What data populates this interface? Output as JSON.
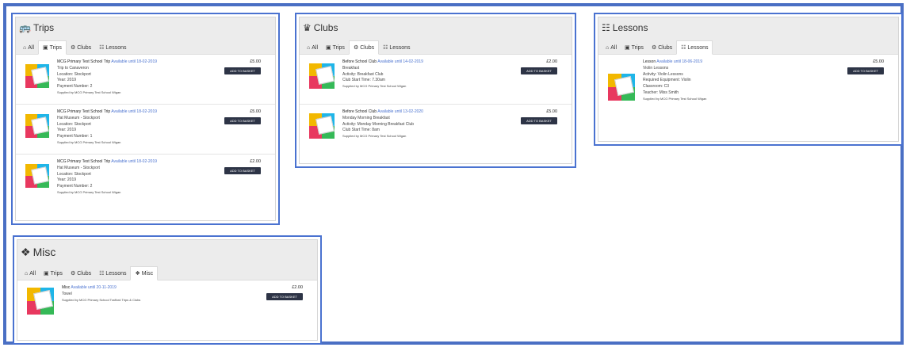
{
  "colors": {
    "frame": "#4a6fc4",
    "panel_border": "#4a72d0",
    "button": "#2d3446",
    "link": "#4a72d0"
  },
  "tab_labels": {
    "all": "All",
    "trips": "Trips",
    "clubs": "Clubs",
    "lessons": "Lessons",
    "misc": "Misc"
  },
  "panels": {
    "trips": {
      "title": "Trips",
      "items": [
        {
          "title": "MCG Primary Test School Trip",
          "available": "Available until 18-02-2019",
          "lines": [
            "Trip to Canaveron",
            "Location: Stockport",
            "Year: 2019",
            "Payment Number: 2"
          ],
          "supplier": "Supplied by MCG Primary Test School Wigan",
          "price": "£5.00",
          "button": "ADD TO BASKET"
        },
        {
          "title": "MCG Primary Test School Trip",
          "available": "Available until 18-02-2019",
          "lines": [
            "Hat Museum - Stockport",
            "Location: Stockport",
            "Year: 2019",
            "Payment Number: 1"
          ],
          "supplier": "Supplied by MCG Primary Test School Wigan",
          "price": "£5.00",
          "button": "ADD TO BASKET"
        },
        {
          "title": "MCG Primary Test School Trip",
          "available": "Available until 18-02-2019",
          "lines": [
            "Hat Museum - Stockport",
            "Location: Stockport",
            "Year: 2019",
            "Payment Number: 2"
          ],
          "supplier": "Supplied by MCG Primary Test School Wigan",
          "price": "£2.00",
          "button": "ADD TO BASKET"
        }
      ]
    },
    "clubs": {
      "title": "Clubs",
      "items": [
        {
          "title": "Before School Club",
          "available": "Available until 14-02-2019",
          "lines": [
            "Breakfast",
            "Activity: Breakfast Club",
            "Club Start Time: 7.30am"
          ],
          "supplier": "Supplied by MCG Primary Test School Wigan",
          "price": "£2.00",
          "button": "ADD TO BASKET"
        },
        {
          "title": "Before School Club",
          "available": "Available until 13-02-2020",
          "lines": [
            "Monday Morning Breakfast",
            "Activity: Monday Morning Breakfast Club",
            "Club Start Time: 8am"
          ],
          "supplier": "Supplied by MCG Primary Test School Wigan",
          "price": "£5.00",
          "button": "ADD TO BASKET"
        }
      ]
    },
    "lessons": {
      "title": "Lessons",
      "items": [
        {
          "title": "Lesson",
          "available": "Available until 18-06-2019",
          "lines": [
            "Violin Lessons",
            "Activity: Violin Lessons",
            "Required Equipment: Violin",
            "Classroom: C3",
            "Teacher: Miss Smith"
          ],
          "supplier": "Supplied by MCG Primary Test School Wigan",
          "price": "£5.00",
          "button": "ADD TO BASKET"
        }
      ]
    },
    "misc": {
      "title": "Misc",
      "items": [
        {
          "title": "Misc",
          "available": "Available until 20-11-2019",
          "lines": [
            "Towel"
          ],
          "supplier": "Supplied by MCG Primary School Trafford Trips & Clubs",
          "price": "£2.00",
          "button": "ADD TO BASKET"
        }
      ]
    }
  }
}
